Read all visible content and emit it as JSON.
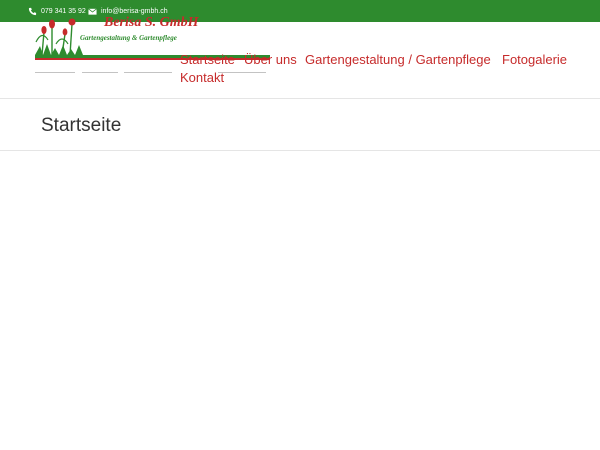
{
  "topbar": {
    "phone": "079 341 35 92",
    "phone_icon": "phone-icon",
    "email": "info@berisa-gmbh.ch",
    "email_icon": "envelope-icon"
  },
  "logo": {
    "name": "Berisa S. GmbH",
    "tagline": "Gartengestaltung & Gartenpflege"
  },
  "nav": {
    "items": [
      {
        "label": "Startseite"
      },
      {
        "label": "Über uns"
      },
      {
        "label": "Gartengestaltung / Gartenpflege"
      },
      {
        "label": "Fotogalerie"
      },
      {
        "label": "Kontakt"
      }
    ]
  },
  "page": {
    "title": "Startseite"
  },
  "colors": {
    "topbar": "#2e8b2e",
    "accent": "#c62b2b",
    "text": "#333333"
  }
}
